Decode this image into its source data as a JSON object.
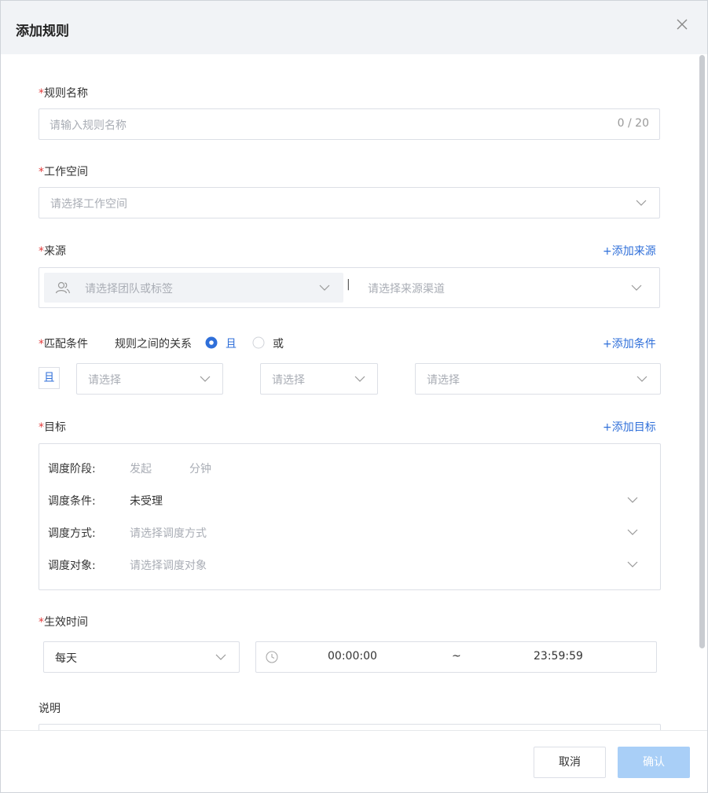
{
  "dialog": {
    "title": "添加规则",
    "close_icon": "close-icon"
  },
  "rule_name": {
    "required_mark": "*",
    "label": "规则名称",
    "placeholder": "请输入规则名称",
    "counter": "0 / 20"
  },
  "workspace": {
    "required_mark": "*",
    "label": "工作空间",
    "placeholder": "请选择工作空间"
  },
  "source": {
    "required_mark": "*",
    "label": "来源",
    "add_link": "+添加来源",
    "team_placeholder": "请选择团队或标签",
    "separator": "|",
    "channel_placeholder": "请选择来源渠道",
    "team_icon": "users-icon"
  },
  "match": {
    "required_mark": "*",
    "label": "匹配条件",
    "relation_label": "规则之间的关系",
    "option_and": "且",
    "option_or": "或",
    "selected": "且",
    "add_link": "+添加条件",
    "row_tag": "且",
    "select_1": "请选择",
    "select_2": "请选择",
    "select_3": "请选择"
  },
  "target": {
    "required_mark": "*",
    "label": "目标",
    "add_link": "+添加目标",
    "stage_label": "调度阶段:",
    "stage_value_1": "发起",
    "stage_value_2": "分钟",
    "condition_label": "调度条件:",
    "condition_value": "未受理",
    "method_label": "调度方式:",
    "method_placeholder": "请选择调度方式",
    "object_label": "调度对象:",
    "object_placeholder": "请选择调度对象"
  },
  "effective": {
    "required_mark": "*",
    "label": "生效时间",
    "frequency": "每天",
    "start_time": "00:00:00",
    "range_sep": "~",
    "end_time": "23:59:59",
    "clock_icon": "clock-icon"
  },
  "description": {
    "label": "说明"
  },
  "footer": {
    "cancel": "取消",
    "confirm": "确认"
  },
  "colors": {
    "accent": "#2f6fd9",
    "required": "#e23b3b",
    "confirm_disabled": "#a9cff7",
    "header_bg": "#f1f3f6"
  }
}
